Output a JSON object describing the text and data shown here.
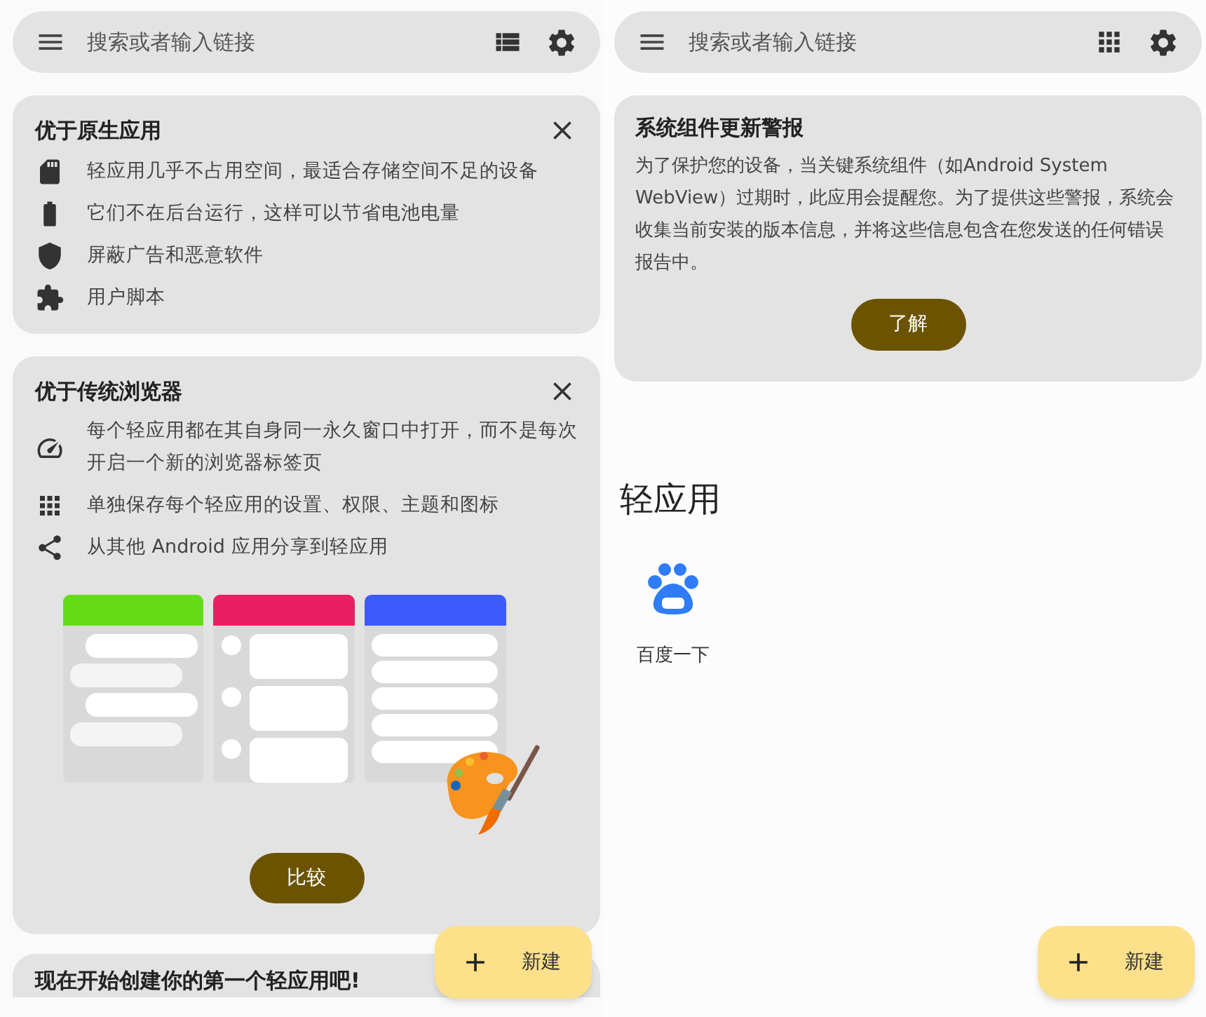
{
  "left_screen": {
    "search_bar": {
      "placeholder": "搜索或者输入链接"
    },
    "cards": [
      {
        "kind": "features",
        "title": "优于原生应用",
        "items": [
          "轻应用几乎不占用空间，最适合存储空间不足的设备",
          "它们不在后台运行，这样可以节省电池电量",
          "屏蔽广告和恶意软件",
          "用户脚本"
        ]
      },
      {
        "kind": "compare",
        "title": "优于传统浏览器",
        "items": [
          "每个轻应用都在其自身同一永久窗口中打开，而不是每次开启一个新的浏览器标签页",
          "单独保存每个轻应用的设置、权限、主题和图标",
          "从其他 Android 应用分享到轻应用"
        ],
        "button": "比较"
      },
      {
        "kind": "cut",
        "title": "现在开始创建你的第一个轻应用吧!"
      }
    ],
    "fab": "新建"
  },
  "right_screen": {
    "search_bar": {
      "placeholder": "搜索或者输入链接"
    },
    "alert": {
      "title": "系统组件更新警报",
      "text": "为了保护您的设备，当关键系统组件（如Android System WebView）过期时，此应用会提醒您。为了提供这些警报，系统会收集当前安装的版本信息，并将这些信息包含在您发送的任何错误报告中。",
      "button": "了解"
    },
    "section_title": "轻应用",
    "apps": [
      {
        "name": "百度一下"
      }
    ],
    "fab": "新建"
  }
}
